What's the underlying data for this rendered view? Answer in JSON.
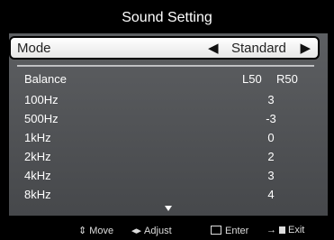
{
  "title": "Sound Setting",
  "mode": {
    "label": "Mode",
    "value": "Standard",
    "left_icon": "triangle-left-icon",
    "right_icon": "triangle-right-icon"
  },
  "balance": {
    "label": "Balance",
    "left": "L50",
    "right": "R50"
  },
  "eq": [
    {
      "label": "100Hz",
      "value": "3"
    },
    {
      "label": "500Hz",
      "value": "-3"
    },
    {
      "label": "1kHz",
      "value": "0"
    },
    {
      "label": "2kHz",
      "value": "2"
    },
    {
      "label": "4kHz",
      "value": "3"
    },
    {
      "label": "8kHz",
      "value": "4"
    }
  ],
  "footer": {
    "move": "Move",
    "adjust": "Adjust",
    "enter": "Enter",
    "exit": "Exit"
  },
  "colors": {
    "panel": "#55575a",
    "highlight": "#f2f2f2",
    "background": "#000000"
  }
}
